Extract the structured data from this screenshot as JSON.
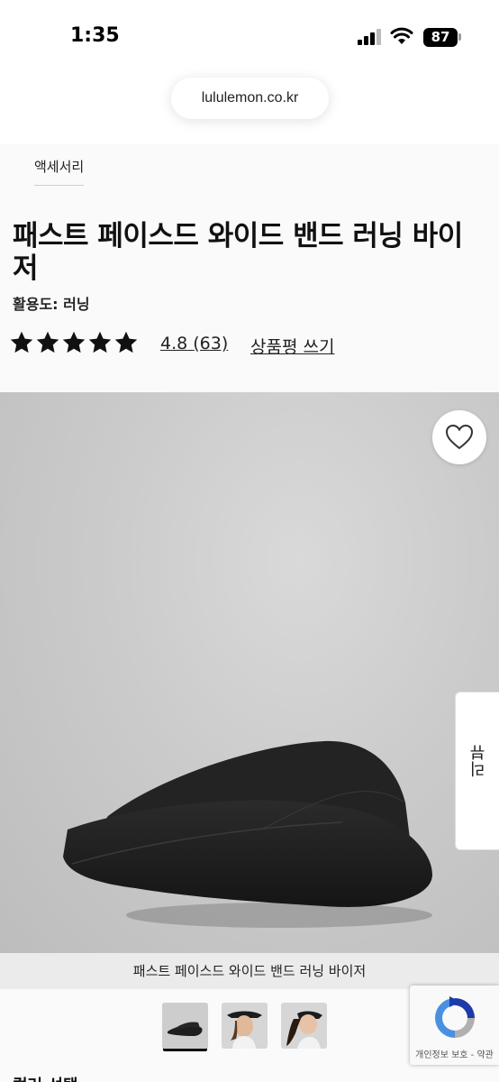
{
  "status_bar": {
    "time": "1:35",
    "battery_level": "87",
    "icons": [
      "signal-icon",
      "wifi-icon",
      "battery-icon"
    ]
  },
  "browser": {
    "url": "lululemon.co.kr"
  },
  "product": {
    "breadcrumb": "액세서리",
    "title": "패스트 페이스드 와이드 밴드 러닝 바이저",
    "activity": "활용도: 러닝",
    "rating_stars": 5,
    "rating": "4.8",
    "review_count": "(63)",
    "write_review": "상품평 쓰기",
    "image_caption": "패스트 페이스드 와이드 밴드 러닝 바이저",
    "reviews_tab": "리뷰",
    "color_select_label": "컬러 선택",
    "thumbnail_count": 3,
    "selected_thumbnail": 1
  },
  "recaptcha": {
    "text": "개인정보 보호 - 약관"
  },
  "colors": {
    "page_bg": "#fafafa",
    "visor": "#1e1e1e",
    "accent": "#111111"
  }
}
